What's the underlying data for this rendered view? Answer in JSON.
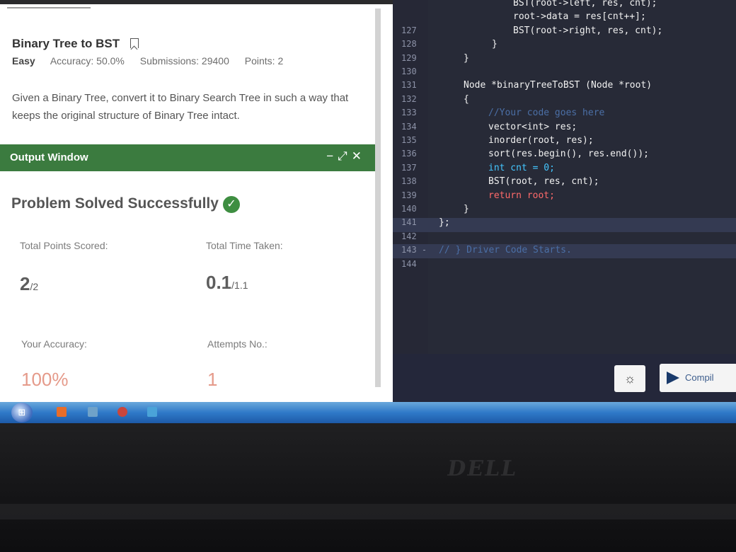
{
  "problem": {
    "title": "Binary Tree to BST",
    "difficulty": "Easy",
    "accuracy": "Accuracy: 50.0%",
    "submissions": "Submissions: 29400",
    "points": "Points: 2",
    "description": "Given a Binary Tree, convert it to Binary Search Tree in such a way that keeps the original structure of Binary Tree intact."
  },
  "output_window": {
    "title": "Output Window",
    "controls": [
      "−",
      "⤢",
      "✕"
    ],
    "status": "Problem Solved Successfully",
    "stats": {
      "points_label": "Total Points Scored:",
      "points_value": "2",
      "points_total": "/2",
      "time_label": "Total Time Taken:",
      "time_value": "0.1",
      "time_total": "/1.1",
      "accuracy_label": "Your Accuracy:",
      "accuracy_value": "100%",
      "attempts_label": "Attempts No.:",
      "attempts_value": "1"
    }
  },
  "editor": {
    "lines": [
      {
        "n": "",
        "t": "BST(root->left, res, cnt);"
      },
      {
        "n": "",
        "t": "root->data = res[cnt++];"
      },
      {
        "n": "127",
        "t": "BST(root->right, res, cnt);"
      },
      {
        "n": "128",
        "t": "}"
      },
      {
        "n": "129",
        "t": "}"
      },
      {
        "n": "130",
        "t": ""
      },
      {
        "n": "131",
        "t": "Node *binaryTreeToBST (Node *root)"
      },
      {
        "n": "132",
        "t": "{"
      },
      {
        "n": "133",
        "t": "//Your code goes here"
      },
      {
        "n": "134",
        "t": "vector<int> res;"
      },
      {
        "n": "135",
        "t": "inorder(root, res);"
      },
      {
        "n": "136",
        "t": "sort(res.begin(), res.end());"
      },
      {
        "n": "137",
        "t": "int cnt = 0;"
      },
      {
        "n": "138",
        "t": "BST(root, res, cnt);"
      },
      {
        "n": "139",
        "t": "return root;"
      },
      {
        "n": "140",
        "t": "}"
      },
      {
        "n": "141",
        "t": "};"
      },
      {
        "n": "142",
        "t": ""
      },
      {
        "n": "143 -",
        "t": "// } Driver Code Starts."
      },
      {
        "n": "144",
        "t": ""
      }
    ],
    "compile_label": "Compil"
  },
  "brand": "DELL",
  "colors": {
    "output_header": "#3b7b3f",
    "editor_bg": "#272a37",
    "accent_red": "#e59a8a"
  }
}
